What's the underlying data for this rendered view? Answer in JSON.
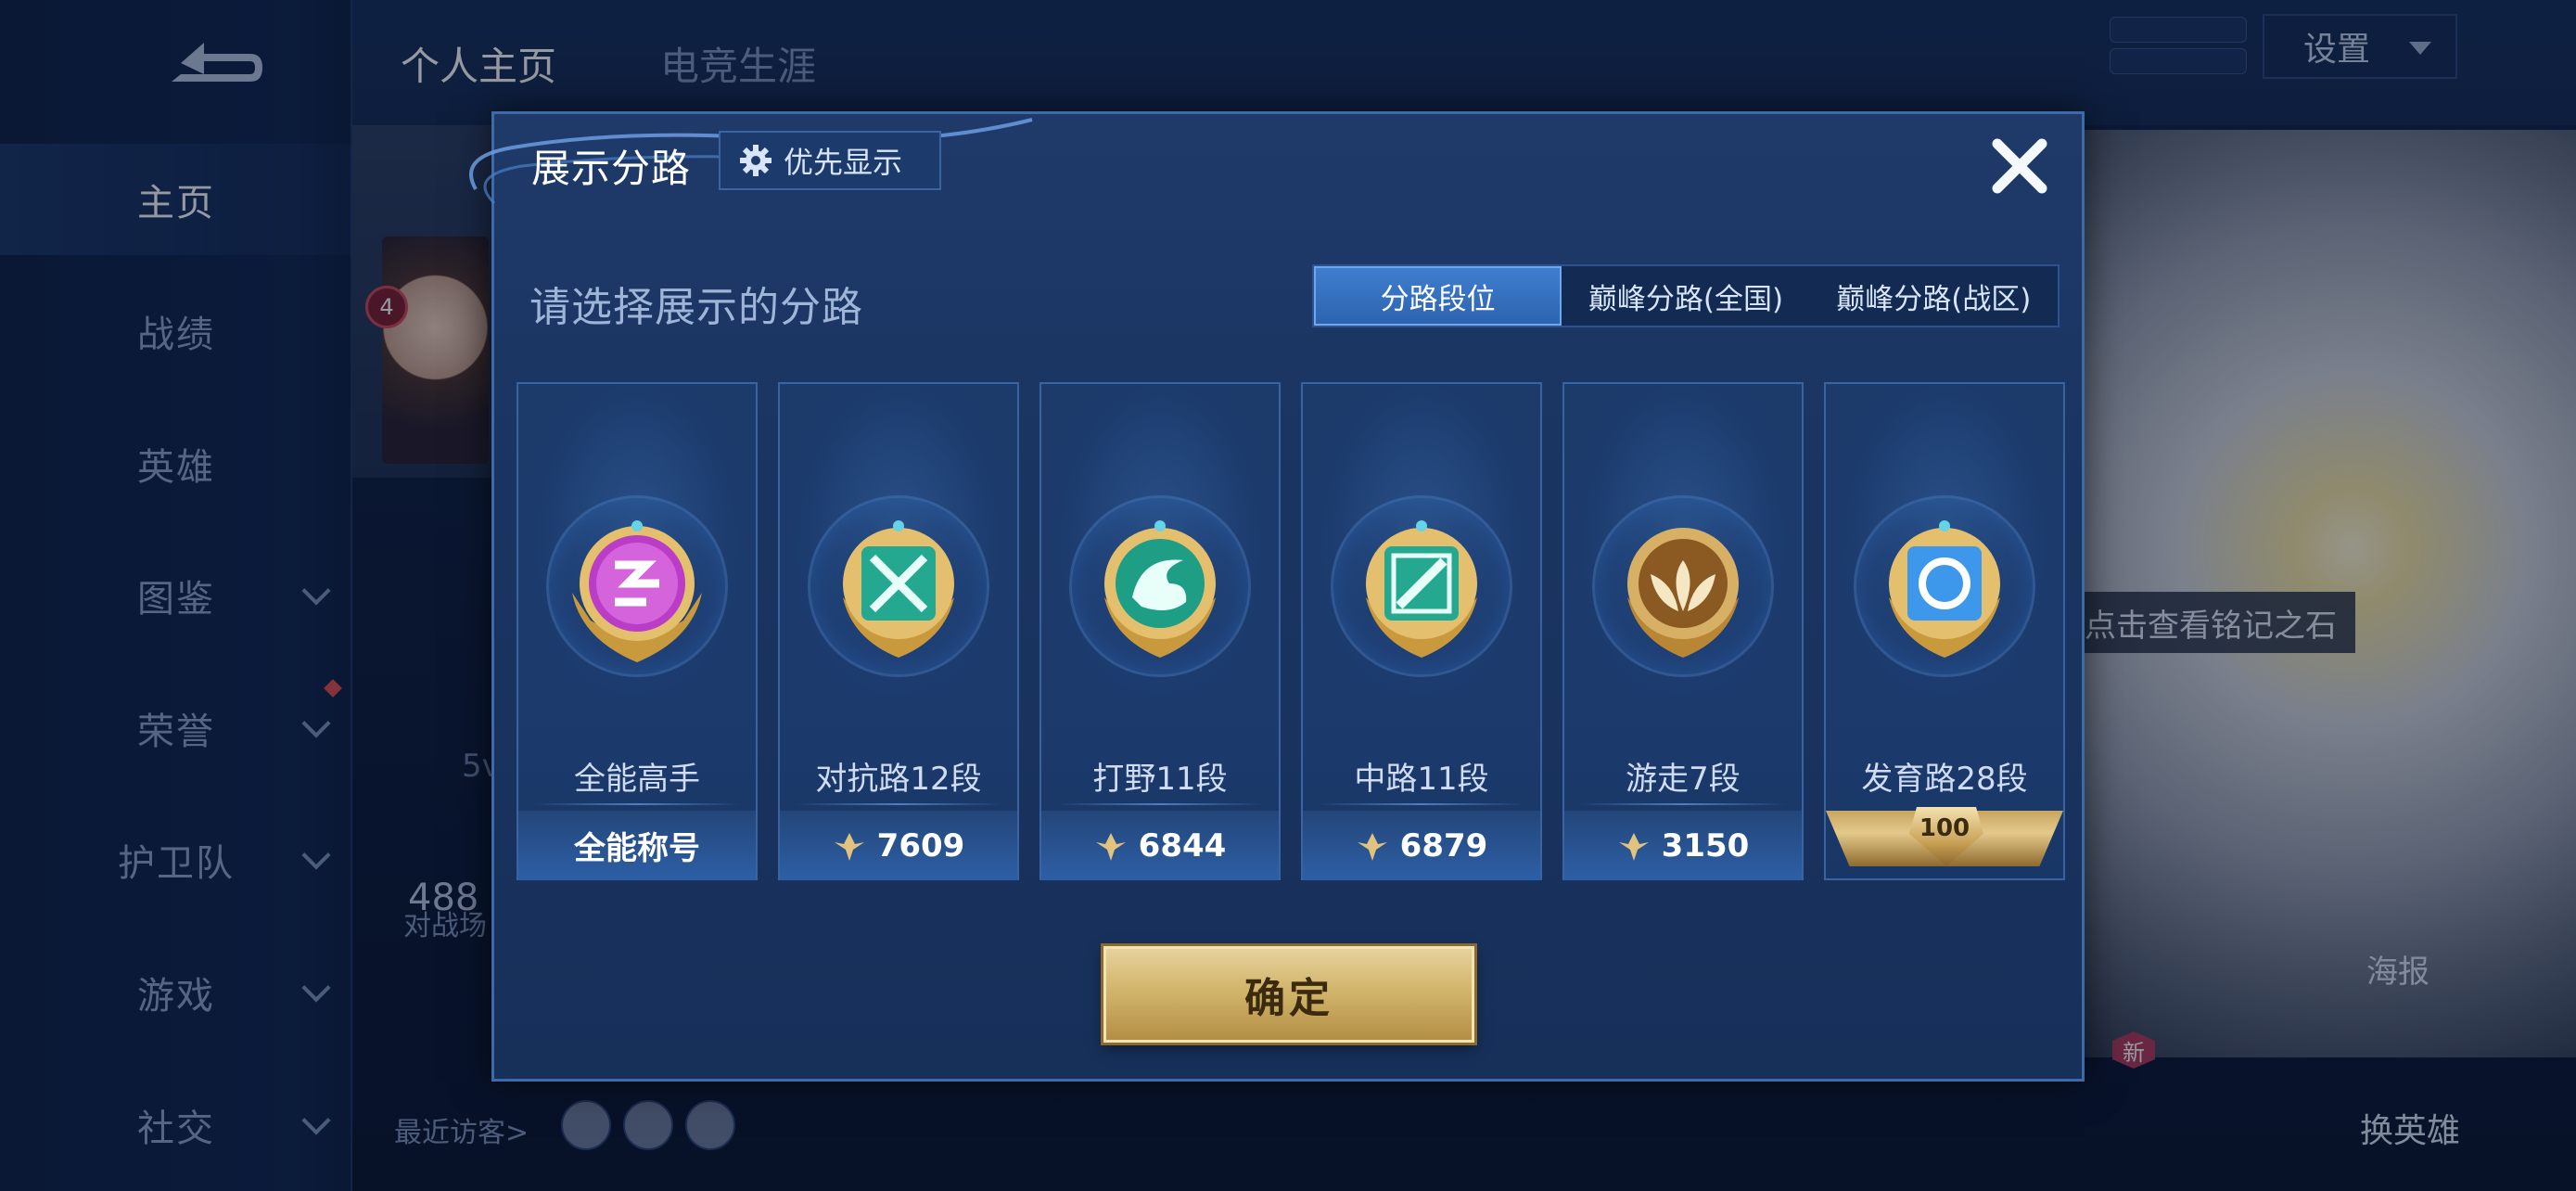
{
  "sidebar": {
    "items": [
      {
        "label": "主页",
        "active": true,
        "has_chevron": false
      },
      {
        "label": "战绩",
        "active": false,
        "has_chevron": false
      },
      {
        "label": "英雄",
        "active": false,
        "has_chevron": false
      },
      {
        "label": "图鉴",
        "active": false,
        "has_chevron": true
      },
      {
        "label": "荣誉",
        "active": false,
        "has_chevron": true
      },
      {
        "label": "护卫队",
        "active": false,
        "has_chevron": true
      },
      {
        "label": "游戏",
        "active": false,
        "has_chevron": true
      },
      {
        "label": "社交",
        "active": false,
        "has_chevron": true
      }
    ]
  },
  "header": {
    "tabs": [
      {
        "label": "个人主页",
        "active": true
      },
      {
        "label": "电竞生涯",
        "active": false
      }
    ],
    "settings_label": "设置"
  },
  "profile": {
    "level_badge": "4",
    "partial_stat_5v": "5v",
    "match_count_partial": "488",
    "match_label_partial": "对战场",
    "visitors_label": "最近访客>"
  },
  "right_panel": {
    "tooltip_partial": "点击查看铭记之石",
    "poster_label": "海报",
    "swap_hero_label": "换英雄",
    "new_tag": "新"
  },
  "modal": {
    "title": "展示分路",
    "priority_button": "优先显示",
    "subtitle": "请选择展示的分路",
    "segment_tabs": [
      {
        "label": "分路段位",
        "active": true
      },
      {
        "label": "巅峰分路(全国)",
        "active": false
      },
      {
        "label": "巅峰分路(战区)",
        "active": false
      }
    ],
    "cards": [
      {
        "title": "全能高手",
        "footer": "全能称号",
        "footer_type": "text",
        "emblem": "all-round-emblem",
        "color": "#c24fd0"
      },
      {
        "title": "对抗路12段",
        "footer": "7609",
        "footer_type": "points",
        "emblem": "clash-lane-emblem",
        "color": "#2fb7a0"
      },
      {
        "title": "打野11段",
        "footer": "6844",
        "footer_type": "points",
        "emblem": "jungle-emblem",
        "color": "#2fb7a0"
      },
      {
        "title": "中路11段",
        "footer": "6879",
        "footer_type": "points",
        "emblem": "mid-lane-emblem",
        "color": "#2fb7a0"
      },
      {
        "title": "游走7段",
        "footer": "3150",
        "footer_type": "points",
        "emblem": "roam-emblem",
        "color": "#d5a24a"
      },
      {
        "title": "发育路28段",
        "footer": "100",
        "footer_type": "badge",
        "emblem": "farm-lane-emblem",
        "color": "#3f9df0"
      }
    ],
    "confirm_label": "确定"
  }
}
